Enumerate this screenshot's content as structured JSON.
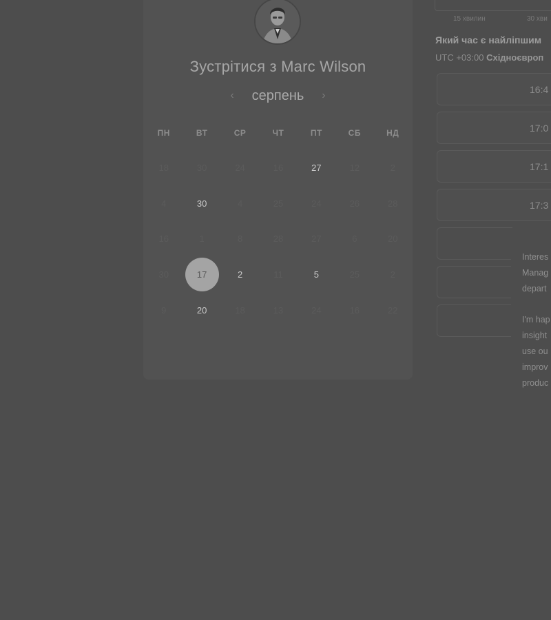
{
  "booking": {
    "title": "Зустрітися з Marc Wilson",
    "month": "серпень",
    "prev_icon": "chevron-left-icon",
    "next_icon": "chevron-right-icon"
  },
  "calendar": {
    "weekdays": [
      "ПН",
      "ВТ",
      "СР",
      "ЧТ",
      "ПТ",
      "СБ",
      "НД"
    ],
    "weeks": [
      [
        {
          "d": "18",
          "available": false
        },
        {
          "d": "30",
          "available": false
        },
        {
          "d": "24",
          "available": false
        },
        {
          "d": "16",
          "available": false
        },
        {
          "d": "27",
          "available": true
        },
        {
          "d": "12",
          "available": false
        },
        {
          "d": "2",
          "available": false
        }
      ],
      [
        {
          "d": "4",
          "available": false
        },
        {
          "d": "30",
          "available": true
        },
        {
          "d": "4",
          "available": false
        },
        {
          "d": "25",
          "available": false
        },
        {
          "d": "24",
          "available": false
        },
        {
          "d": "26",
          "available": false
        },
        {
          "d": "28",
          "available": false
        }
      ],
      [
        {
          "d": "16",
          "available": false
        },
        {
          "d": "1",
          "available": false
        },
        {
          "d": "8",
          "available": false
        },
        {
          "d": "28",
          "available": false
        },
        {
          "d": "27",
          "available": false
        },
        {
          "d": "6",
          "available": false
        },
        {
          "d": "20",
          "available": false
        }
      ],
      [
        {
          "d": "30",
          "available": false
        },
        {
          "d": "17",
          "available": true,
          "selected": true
        },
        {
          "d": "2",
          "available": true
        },
        {
          "d": "11",
          "available": false
        },
        {
          "d": "5",
          "available": true
        },
        {
          "d": "25",
          "available": false
        },
        {
          "d": "2",
          "available": false
        }
      ],
      [
        {
          "d": "9",
          "available": false
        },
        {
          "d": "20",
          "available": true
        },
        {
          "d": "18",
          "available": false
        },
        {
          "d": "13",
          "available": false
        },
        {
          "d": "24",
          "available": false
        },
        {
          "d": "16",
          "available": false
        },
        {
          "d": "22",
          "available": false
        }
      ]
    ]
  },
  "duration": {
    "tabs": [
      "15 хвилин",
      "30 хви"
    ]
  },
  "times": {
    "heading": "Який час є найліпшим",
    "tz_prefix": "UTC +03:00",
    "tz_name": "Східноєвроп",
    "slots": [
      "16:4",
      "17:0",
      "17:1",
      "17:3"
    ]
  },
  "note": {
    "para1": [
      "Interes",
      "Manag",
      "depart"
    ],
    "para2": [
      "I'm hap",
      "insight",
      "use ou",
      "improv",
      "produc"
    ]
  },
  "colors": {
    "overlay_background": "#4d4d4d",
    "selected_day": "#a4a4a4"
  }
}
